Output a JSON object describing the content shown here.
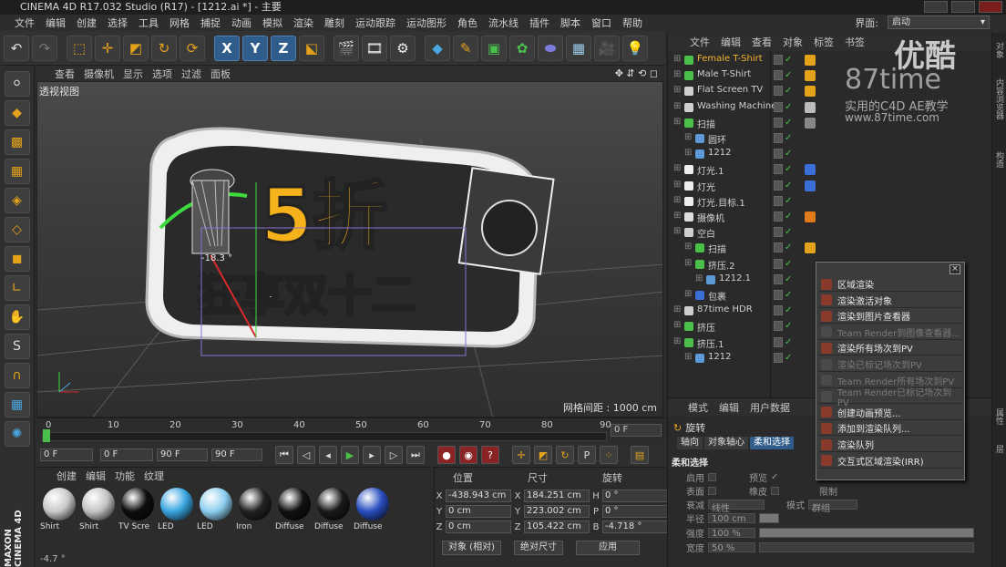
{
  "window": {
    "title": "CINEMA 4D R17.032 Studio (R17) - [1212.ai *] - 主要"
  },
  "menubar": {
    "items": [
      "文件",
      "编辑",
      "创建",
      "选择",
      "工具",
      "网格",
      "捕捉",
      "动画",
      "模拟",
      "渲染",
      "雕刻",
      "运动跟踪",
      "运动图形",
      "角色",
      "流水线",
      "插件",
      "脚本",
      "窗口",
      "帮助"
    ],
    "layout_label": "界面:",
    "layout_value": "启动"
  },
  "viewport": {
    "menu": [
      "查看",
      "摄像机",
      "显示",
      "选项",
      "过滤",
      "面板"
    ],
    "label": "透视视图",
    "grid_label": "网格间距 : 1000 cm",
    "scene_text_main": "5折",
    "scene_text_sub": "狂享双十二",
    "axis_label": "-18.3 °"
  },
  "timeline": {
    "ticks": [
      "0",
      "10",
      "20",
      "30",
      "40",
      "50",
      "60",
      "70",
      "80",
      "90"
    ],
    "frame_field": "0 F",
    "current_frame": 0
  },
  "transport": {
    "start_field": "0 F",
    "range_start": "0 F",
    "range_end": "90 F",
    "end_field": "90 F"
  },
  "materials": {
    "menu": [
      "创建",
      "编辑",
      "功能",
      "纹理"
    ],
    "items": [
      {
        "name": "Shirt",
        "color": "#c9c9c9"
      },
      {
        "name": "Shirt",
        "color": "#c3c3c3"
      },
      {
        "name": "TV Scre",
        "color": "#0e0e0e"
      },
      {
        "name": "LED",
        "color": "#3aa6e0"
      },
      {
        "name": "LED",
        "color": "#8ecff0"
      },
      {
        "name": "Iron",
        "color": "#222222"
      },
      {
        "name": "Diffuse",
        "color": "#111111"
      },
      {
        "name": "Diffuse",
        "color": "#1a1a1a"
      },
      {
        "name": "Diffuse",
        "color": "#2a4fc0"
      }
    ]
  },
  "coordinates": {
    "headers": [
      "位置",
      "尺寸",
      "旋转"
    ],
    "rows": [
      {
        "axis": "X",
        "pos": "-438.943 cm",
        "size_axis": "X",
        "size": "184.251 cm",
        "rot_axis": "H",
        "rot": "0 °"
      },
      {
        "axis": "Y",
        "pos": "0 cm",
        "size_axis": "Y",
        "size": "223.002 cm",
        "rot_axis": "P",
        "rot": "0 °"
      },
      {
        "axis": "Z",
        "pos": "0 cm",
        "size_axis": "Z",
        "size": "105.422 cm",
        "rot_axis": "B",
        "rot": "-4.718 °"
      }
    ],
    "mode_select": "对象 (相对)",
    "size_select": "绝对尺寸",
    "apply_button": "应用"
  },
  "objects": {
    "menu": [
      "文件",
      "编辑",
      "查看",
      "对象",
      "标签",
      "书签"
    ],
    "rows": [
      {
        "name": "Female T-Shirt",
        "indent": 0,
        "highlight": true,
        "icon": "#4ac04a",
        "tag": "#e3a21a"
      },
      {
        "name": "Male T-Shirt",
        "indent": 0,
        "highlight": false,
        "icon": "#4ac04a",
        "tag": "#e3a21a"
      },
      {
        "name": "Flat Screen TV",
        "indent": 0,
        "highlight": false,
        "icon": "#cfcfcf",
        "tag": "#e3a21a"
      },
      {
        "name": "Washing Machine",
        "indent": 0,
        "highlight": false,
        "icon": "#cfcfcf",
        "tag": "#bbbbbb"
      },
      {
        "name": "扫描",
        "indent": 0,
        "highlight": false,
        "icon": "#4ac04a",
        "tag": "#888888"
      },
      {
        "name": "圆环",
        "indent": 1,
        "highlight": false,
        "icon": "#5c9ad8",
        "tag": ""
      },
      {
        "name": "1212",
        "indent": 1,
        "highlight": false,
        "icon": "#5c9ad8",
        "tag": ""
      },
      {
        "name": "灯光.1",
        "indent": 0,
        "highlight": false,
        "icon": "#eeeeee",
        "tag": "#3b6fd8"
      },
      {
        "name": "灯光",
        "indent": 0,
        "highlight": false,
        "icon": "#eeeeee",
        "tag": "#3b6fd8"
      },
      {
        "name": "灯光.目标.1",
        "indent": 0,
        "highlight": false,
        "icon": "#eeeeee",
        "tag": ""
      },
      {
        "name": "摄像机",
        "indent": 0,
        "highlight": false,
        "icon": "#dddddd",
        "tag": "#e37a1a"
      },
      {
        "name": "空白",
        "indent": 0,
        "highlight": false,
        "icon": "#cfcfcf",
        "tag": ""
      },
      {
        "name": "扫描",
        "indent": 1,
        "highlight": false,
        "icon": "#4ac04a",
        "tag": "#e3a21a"
      },
      {
        "name": "挤压.2",
        "indent": 1,
        "highlight": false,
        "icon": "#4ac04a",
        "tag": ""
      },
      {
        "name": "1212.1",
        "indent": 2,
        "highlight": false,
        "icon": "#5c9ad8",
        "tag": ""
      },
      {
        "name": "包裹",
        "indent": 1,
        "highlight": false,
        "icon": "#3b6fd8",
        "tag": ""
      },
      {
        "name": "87time HDR",
        "indent": 0,
        "highlight": false,
        "icon": "#cfcfcf",
        "tag": ""
      },
      {
        "name": "挤压",
        "indent": 0,
        "highlight": false,
        "icon": "#4ac04a",
        "tag": ""
      },
      {
        "name": "挤压.1",
        "indent": 0,
        "highlight": false,
        "icon": "#4ac04a",
        "tag": ""
      },
      {
        "name": "1212",
        "indent": 1,
        "highlight": false,
        "icon": "#5c9ad8",
        "tag": ""
      }
    ]
  },
  "attributes": {
    "menu": [
      "模式",
      "编辑",
      "用户数据"
    ],
    "title": "旋转",
    "tabs": [
      "轴向",
      "对象轴心",
      "柔和选择"
    ],
    "active_tab": "柔和选择",
    "section": "柔和选择",
    "enable_label": "启用",
    "preview_label": "预览",
    "surface_label": "表面",
    "rubber_label": "橡皮",
    "limit_label": "限制",
    "falloff_label": "衰减",
    "falloff_value": "线性",
    "mode_label": "模式",
    "mode_value": "群组",
    "radius_label": "半径",
    "radius_value": "100 cm",
    "strength_label": "强度",
    "strength_value": "100 %",
    "width_label": "宽度",
    "width_value": "50 %"
  },
  "context_menu": {
    "items": [
      {
        "label": "区域渲染",
        "enabled": true
      },
      {
        "label": "渲染激活对象",
        "enabled": true
      },
      {
        "label": "渲染到图片查看器",
        "enabled": true
      },
      {
        "label": "Team Render到图像查看器...",
        "enabled": false
      },
      {
        "label": "渲染所有场次到PV",
        "enabled": true
      },
      {
        "label": "渲染已标记场次到PV",
        "enabled": false
      },
      {
        "label": "Team Render所有场次到PV",
        "enabled": false
      },
      {
        "label": "Team Render已标记场次到PV",
        "enabled": false
      },
      {
        "label": "创建动画预览...",
        "enabled": true
      },
      {
        "label": "添加到渲染队列...",
        "enabled": true
      },
      {
        "label": "渲染队列",
        "enabled": true
      },
      {
        "label": "交互式区域渲染(IRR)",
        "enabled": true
      }
    ]
  },
  "watermark": {
    "brand": "优酷",
    "number": "87time",
    "subtitle": "实用的C4D AE教学",
    "url": "www.87time.com"
  },
  "brand_vertical": "MAXON CINEMA 4D",
  "right_strip": [
    "对象",
    "内容浏览器",
    "构造",
    "属性",
    "层"
  ],
  "status": "-4.7 °"
}
